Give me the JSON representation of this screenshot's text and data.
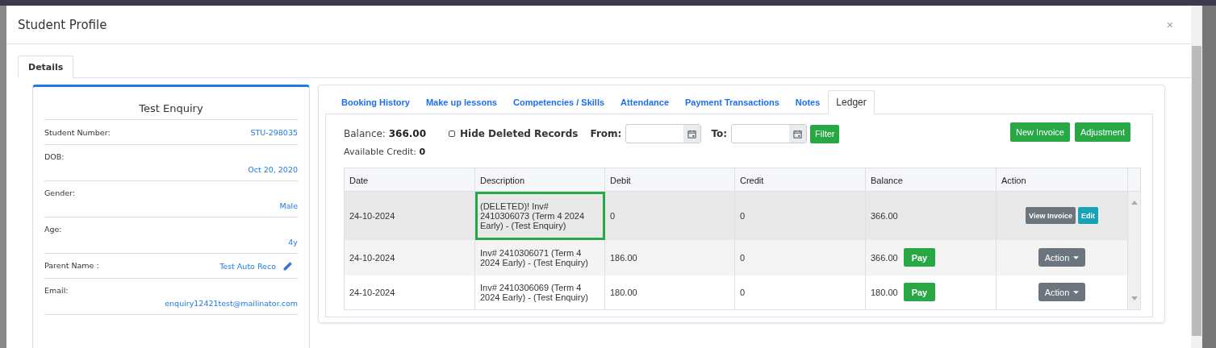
{
  "window": {
    "title": "Student Profile",
    "close": "×"
  },
  "tabs": [
    {
      "label": "Details",
      "selected": true
    }
  ],
  "profile": {
    "name": "Test Enquiry",
    "fields": [
      {
        "label": "Student Number:",
        "value": "STU-298035",
        "kind": "inline"
      },
      {
        "label": "DOB:",
        "value": "Oct 20, 2020",
        "kind": "below"
      },
      {
        "label": "Gender:",
        "value": "Male",
        "kind": "below"
      },
      {
        "label": "Age:",
        "value": "4y",
        "kind": "below"
      },
      {
        "label": "Parent Name :",
        "value": "Test Auto Reco",
        "kind": "editable"
      },
      {
        "label": "Email:",
        "value": "enquiry12421test@mailinator.com",
        "kind": "below"
      }
    ]
  },
  "subtabs": [
    {
      "label": "Booking History",
      "selected": false
    },
    {
      "label": "Make up lessons",
      "selected": false
    },
    {
      "label": "Competencies / Skills",
      "selected": false
    },
    {
      "label": "Attendance",
      "selected": false
    },
    {
      "label": "Payment Transactions",
      "selected": false
    },
    {
      "label": "Notes",
      "selected": false
    },
    {
      "label": "Ledger",
      "selected": true
    }
  ],
  "ledger": {
    "balance_label": "Balance:",
    "balance": "366.00",
    "credit_label": "Available Credit:",
    "credit": "0",
    "hide_deleted": {
      "label": "Hide Deleted Records",
      "checked": false
    },
    "from_label": "From:",
    "to_label": "To:",
    "filter": "Filter",
    "buttons": [
      "New Invoice",
      "Adjustment"
    ],
    "columns": [
      "Date",
      "Description",
      "Debit",
      "Credit",
      "Balance",
      "Action"
    ],
    "rows": [
      {
        "kind": "deleted",
        "highlighted": true,
        "date": "24-10-2024",
        "description": "(DELETED)! Inv# 2410306073 (Term 4 2024 Early) - (Test Enquiry)",
        "debit": "0",
        "credit": "0",
        "balance": "366.00",
        "actions": [
          "View Invoice",
          "Edit"
        ]
      },
      {
        "kind": "invoice",
        "highlighted": false,
        "date": "24-10-2024",
        "description": "Inv# 2410306071 (Term 4 2024 Early) - (Test Enquiry)",
        "debit": "186.00",
        "credit": "0",
        "balance": "366.00",
        "pay": "Pay",
        "actions": [
          "Action"
        ]
      },
      {
        "kind": "invoice",
        "highlighted": false,
        "date": "24-10-2024",
        "description": "Inv# 2410306069 (Term 4 2024 Early) - (Test Enquiry)",
        "debit": "180.00",
        "credit": "0",
        "balance": "180.00",
        "pay": "Pay",
        "actions": [
          "Action"
        ]
      }
    ]
  }
}
